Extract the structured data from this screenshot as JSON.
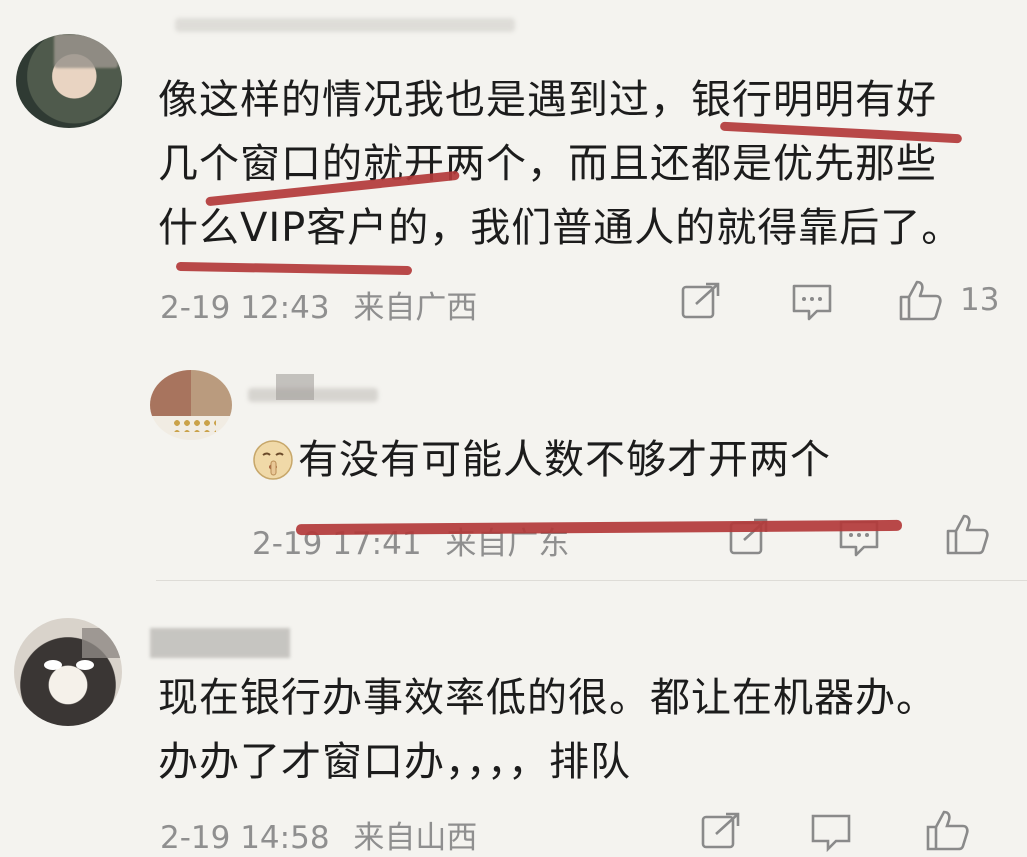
{
  "comments": [
    {
      "text_lines": [
        "像这样的情况我也是遇到过，银行明明有好",
        "几个窗口的就开两个，而且还都是优先那些",
        "什么VIP客户的，我们普通人的就得靠后了。"
      ],
      "time": "2-19 12:43",
      "location": "来自广西",
      "like_count": "13"
    },
    {
      "emoji": "shushing-face",
      "text": "有没有可能人数不够才开两个",
      "time": "2-19 17:41",
      "location": "来自广东"
    },
    {
      "text_lines": [
        "现在银行办事效率低的很。都让在机器办。",
        "办办了才窗口办，，，，排队"
      ],
      "time": "2-19 14:58",
      "location": "来自山西"
    }
  ],
  "colors": {
    "background": "#f4f3ef",
    "annotation": "#b23a3a",
    "meta": "#8f8f8f"
  },
  "icons": [
    "share-icon",
    "comment-icon",
    "like-icon"
  ]
}
